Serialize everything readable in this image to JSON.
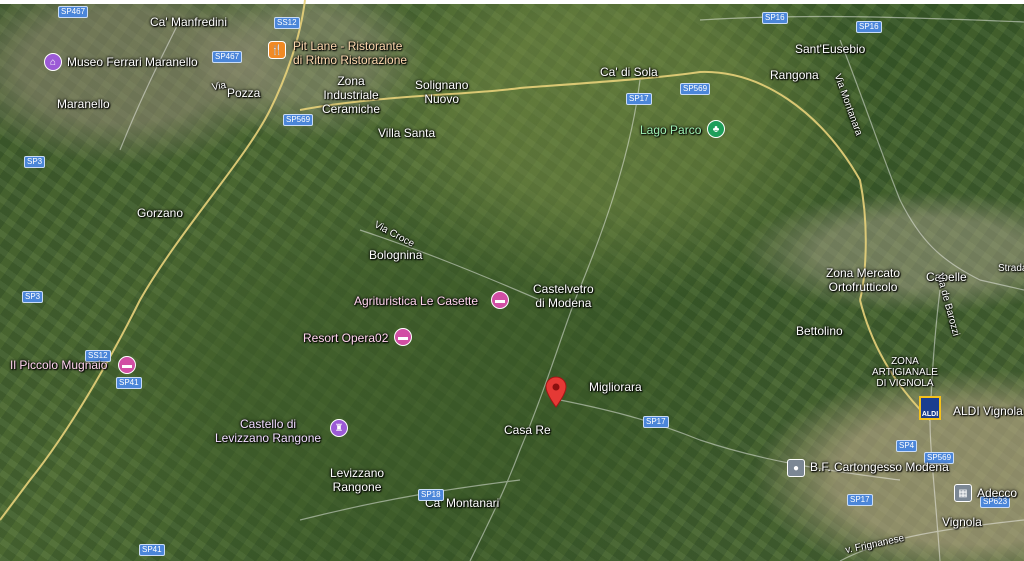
{
  "places": {
    "ca_manfredini": "Ca' Manfredini",
    "maranello": "Maranello",
    "pozza": "Pozza",
    "zona_industriale": "Zona\nIndustriale\nCeramiche",
    "solignano": "Solignano\nNuovo",
    "villa_santa": "Villa Santa",
    "ca_di_sola": "Ca' di Sola",
    "sant_eusebio": "Sant'Eusebio",
    "rangona": "Rangona",
    "gorzano": "Gorzano",
    "bolognina": "Bolognina",
    "castelvetro": "Castelvetro\ndi Modena",
    "migliorara": "Migliorara",
    "casa_re": "Casa Re",
    "levizzano": "Levizzano\nRangone",
    "ca_montanari": "Ca' Montanari",
    "zona_mercato": "Zona Mercato\nOrtofrutticolo",
    "cabelle": "Cabelle",
    "bettolino": "Bettolino",
    "zona_artigianale": "ZONA\nARTIGIANALE\nDI VIGNOLA",
    "vignola": "Vignola",
    "strada": "Strada"
  },
  "pois": {
    "museo": "Museo Ferrari Maranello",
    "pit_lane": "Pit Lane - Ristorante\ndi Ritmo Ristorazione",
    "lago_parco": "Lago Parco",
    "agriturismo": "Agrituristica Le Casette",
    "resort": "Resort Opera02",
    "piccolo": "Il Piccolo Mugnaio",
    "castello": "Castello di\nLevizzano Rangone",
    "aldi": "ALDI Vignola",
    "bf": "B.F. Cartongesso Modena",
    "adecco": "Adecco"
  },
  "roads": {
    "via_croce": "Via Croce",
    "via_montanara": "Via Montanara",
    "via_de_barozzi": "Via de Barozzi",
    "via_frignanese": "v. Frignanese",
    "via_other": "Via"
  },
  "shields": {
    "sp467a": "SP467",
    "sp12a": "SS12",
    "sp467b": "SP467",
    "sp569a": "SP569",
    "sp3a": "SP3",
    "sp3b": "SP3",
    "ss12b": "SS12",
    "sp41a": "SP41",
    "sp41b": "SP41",
    "sp17a": "SP17",
    "sp569b": "SP569",
    "sp16a": "SP16",
    "sp16b": "SP16",
    "sp17b": "SP17",
    "sp4": "SP4",
    "sp569c": "SP569",
    "sp17c": "SP17",
    "sp18": "SP18",
    "sp623": "SP623"
  },
  "aldi_logo": "ALDI",
  "colors": {
    "pin": "#e53935",
    "poi_pink": "#d14fa4",
    "poi_orange": "#f08a24",
    "poi_green": "#1e9e5a",
    "road": "#e8d27a",
    "shield": "#4b86d9"
  }
}
